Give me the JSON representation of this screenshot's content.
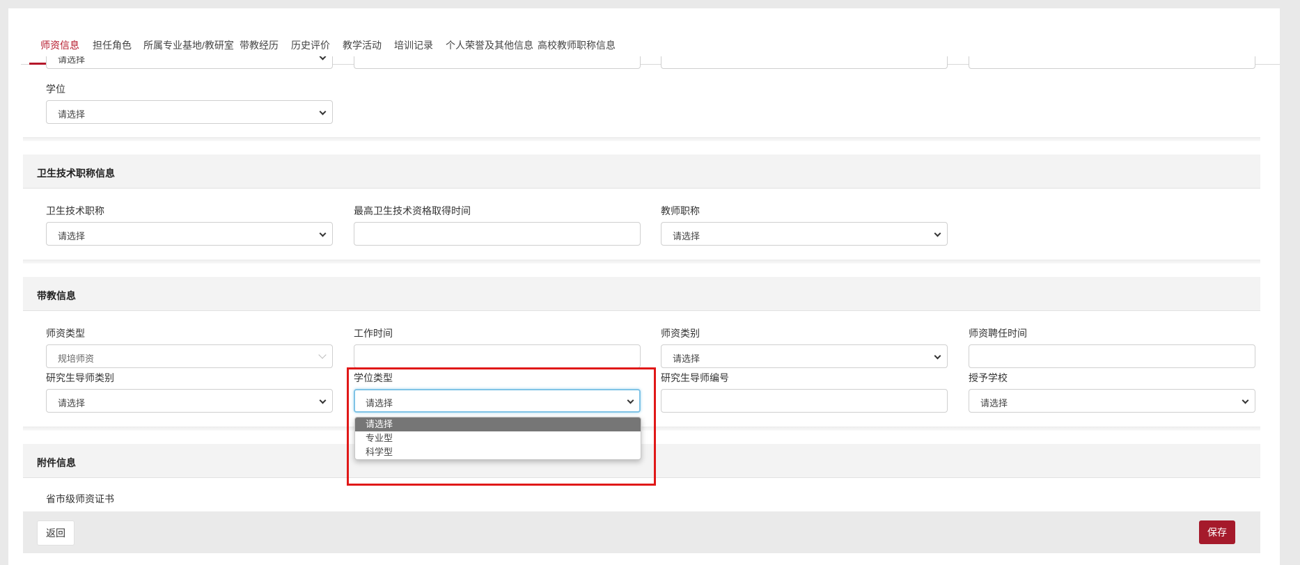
{
  "tabs": [
    {
      "label": "师资信息",
      "active": true
    },
    {
      "label": "担任角色"
    },
    {
      "label": "所属专业基地/教研室"
    },
    {
      "label": "带教经历"
    },
    {
      "label": "历史评价"
    },
    {
      "label": "教学活动"
    },
    {
      "label": "培训记录"
    },
    {
      "label": "个人荣誉及其他信息"
    },
    {
      "label": "高校教师职称信息"
    }
  ],
  "degree_section": {
    "partial_select_value": "请选择",
    "degree_label": "学位",
    "degree_value": "请选择"
  },
  "health_title_section": {
    "title": "卫生技术职称信息",
    "fields": [
      {
        "label": "卫生技术职称",
        "value": "请选择"
      },
      {
        "label": "最高卫生技术资格取得时间",
        "value": ""
      },
      {
        "label": "教师职称",
        "value": "请选择"
      }
    ]
  },
  "teaching_section": {
    "title": "带教信息",
    "row1": [
      {
        "label": "师资类型",
        "value": "规培师资"
      },
      {
        "label": "工作时间",
        "value": ""
      },
      {
        "label": "师资类别",
        "value": "请选择"
      },
      {
        "label": "师资聘任时间",
        "value": ""
      }
    ],
    "row2": [
      {
        "label": "研究生导师类别",
        "value": "请选择"
      },
      {
        "label": "学位类型",
        "value": "请选择"
      },
      {
        "label": "研究生导师编号",
        "value": ""
      },
      {
        "label": "授予学校",
        "value": "请选择"
      }
    ]
  },
  "degree_type_dropdown": {
    "options": [
      "请选择",
      "专业型",
      "科学型"
    ],
    "selected": "请选择"
  },
  "attachment_section": {
    "title": "附件信息",
    "cert_label": "省市级师资证书"
  },
  "footer": {
    "back_label": "返回",
    "save_label": "保存"
  },
  "colors": {
    "accent": "#b5172a",
    "save_button": "#a51a2b",
    "highlight": "#e01818"
  }
}
